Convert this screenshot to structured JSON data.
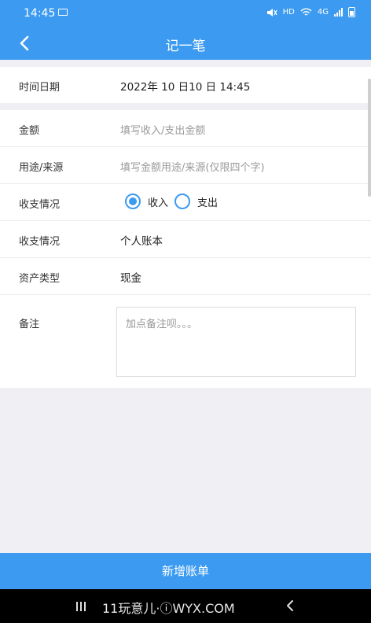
{
  "status_bar": {
    "time": "14:45",
    "network_hd": "HD",
    "network_4g": "4G"
  },
  "header": {
    "title": "记一笔"
  },
  "datetime": {
    "label": "时间日期",
    "value": "2022年 10 日10 日  14:45"
  },
  "form": {
    "amount": {
      "label": "金额",
      "placeholder": "填写收入/支出金额"
    },
    "purpose": {
      "label": "用途/来源",
      "placeholder": "填写金额用途/来源(仅限四个字)"
    },
    "flow": {
      "label": "收支情况",
      "options": [
        "收入",
        "支出"
      ],
      "selected": "收入"
    },
    "account": {
      "label": "收支情况",
      "value": "个人账本"
    },
    "asset": {
      "label": "资产类型",
      "value": "现金"
    },
    "remark": {
      "label": "备注",
      "placeholder": "加点备注呗。。。"
    }
  },
  "submit_label": "新增账单",
  "system_nav": {
    "watermark": "11玩意儿·ⓘWYX.COM"
  },
  "colors": {
    "primary": "#3c9bf0",
    "background": "#efeff4"
  }
}
